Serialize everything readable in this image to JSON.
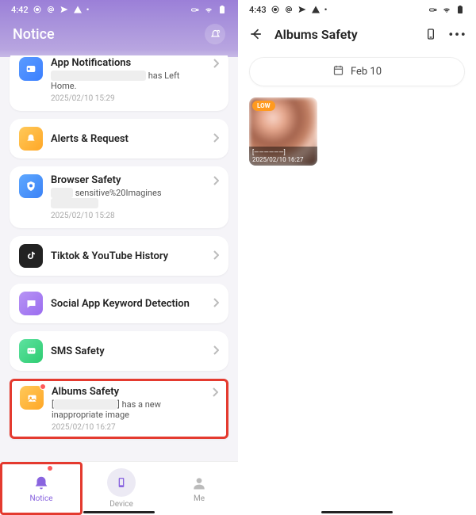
{
  "left": {
    "status": {
      "time": "4:42",
      "icons": [
        "target",
        "at",
        "paperplane",
        "warn",
        "dot"
      ],
      "right_icons": [
        "vpn",
        "wifi",
        "battery"
      ]
    },
    "header_title": "Notice",
    "cards": [
      {
        "key": "app-notifications",
        "title": "App Notifications",
        "sub_suffix": "has Left",
        "sub_line2": "Home.",
        "date": "2025/02/10 15:29",
        "color": "#4a86ff"
      },
      {
        "key": "alerts-request",
        "title": "Alerts & Request",
        "color": "#ffb02e"
      },
      {
        "key": "browser-safety",
        "title": "Browser Safety",
        "sub_masked": "sensitive%20Imagines",
        "date": "2025/02/10 15:28",
        "color": "#3b82f6"
      },
      {
        "key": "tiktok-youtube",
        "title": "Tiktok & YouTube History",
        "color": "#222"
      },
      {
        "key": "social-keyword",
        "title": "Social App Keyword Detection",
        "color": "#9b6cf0"
      },
      {
        "key": "sms-safety",
        "title": "SMS Safety",
        "color": "#2ecc71"
      },
      {
        "key": "albums-safety",
        "title": "Albums Safety",
        "sub_prefix": "[",
        "sub_suffix": "] has a new",
        "sub_line2": "inappropriate image",
        "date": "2025/02/10 16:27",
        "color": "#ffb02e"
      }
    ],
    "nav": {
      "notice": "Notice",
      "device": "Device",
      "me": "Me"
    }
  },
  "right": {
    "status": {
      "time": "4:43",
      "icons": [
        "target",
        "at",
        "paperplane",
        "warn",
        "dot"
      ],
      "right_icons": [
        "vpn",
        "wifi",
        "battery"
      ]
    },
    "title": "Albums Safety",
    "date_label": "Feb 10",
    "thumb": {
      "tag": "LOW",
      "top_line_masked": "[——————]",
      "date": "2025/02/10 16:27"
    }
  }
}
